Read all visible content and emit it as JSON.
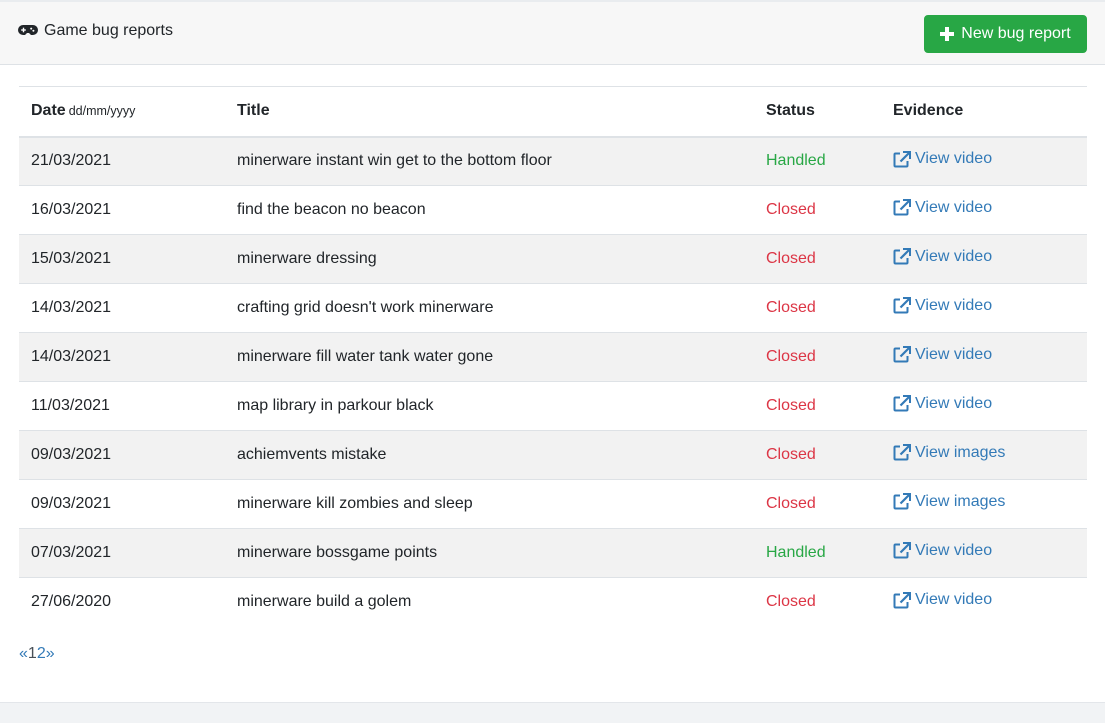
{
  "header": {
    "brand_icon": "gamepad-icon",
    "title": "Game bug reports",
    "new_button_icon": "plus-icon",
    "new_button_label": "New bug report"
  },
  "table": {
    "columns": {
      "date": "Date",
      "date_format": "dd/mm/yyyy",
      "title": "Title",
      "status": "Status",
      "evidence": "Evidence"
    },
    "rows": [
      {
        "date": "21/03/2021",
        "title": "minerware instant win get to the bottom floor",
        "status": "Handled",
        "evidence": "View video"
      },
      {
        "date": "16/03/2021",
        "title": "find the beacon no beacon",
        "status": "Closed",
        "evidence": "View video"
      },
      {
        "date": "15/03/2021",
        "title": "minerware dressing",
        "status": "Closed",
        "evidence": "View video"
      },
      {
        "date": "14/03/2021",
        "title": "crafting grid doesn't work minerware",
        "status": "Closed",
        "evidence": "View video"
      },
      {
        "date": "14/03/2021",
        "title": "minerware fill water tank water gone",
        "status": "Closed",
        "evidence": "View video"
      },
      {
        "date": "11/03/2021",
        "title": "map library in parkour black",
        "status": "Closed",
        "evidence": "View video"
      },
      {
        "date": "09/03/2021",
        "title": "achiemvents mistake",
        "status": "Closed",
        "evidence": "View images"
      },
      {
        "date": "09/03/2021",
        "title": "minerware kill zombies and sleep",
        "status": "Closed",
        "evidence": "View images"
      },
      {
        "date": "07/03/2021",
        "title": "minerware bossgame points",
        "status": "Handled",
        "evidence": "View video"
      },
      {
        "date": "27/06/2020",
        "title": "minerware build a golem",
        "status": "Closed",
        "evidence": "View video"
      }
    ],
    "evidence_icon": "external-link-icon"
  },
  "pagination": {
    "prev": "«",
    "pages": [
      "1",
      "2"
    ],
    "current": "1",
    "next": "»"
  },
  "colors": {
    "handled": "#28a745",
    "closed": "#dc3545",
    "link": "#337ab7",
    "button": "#28a745"
  }
}
